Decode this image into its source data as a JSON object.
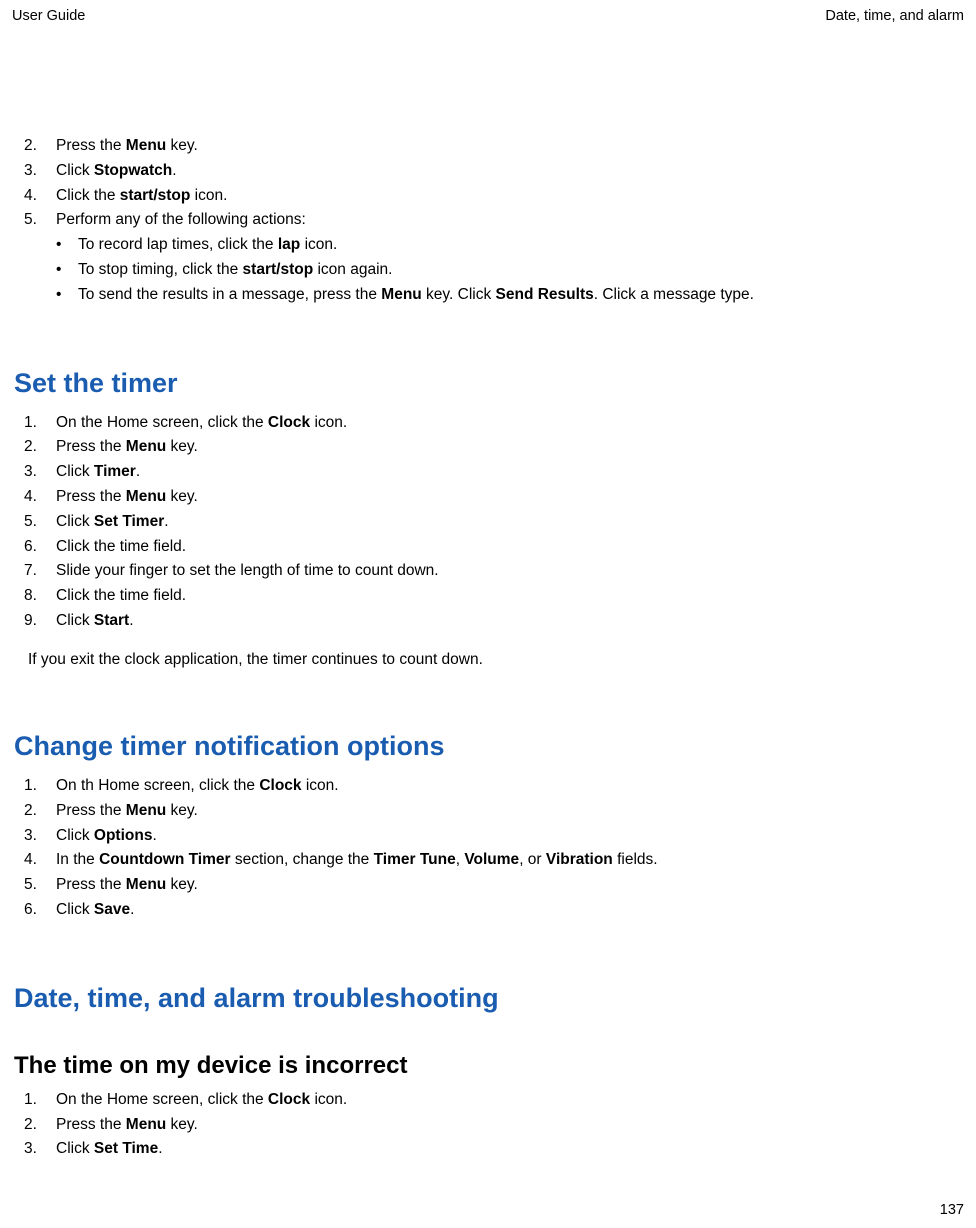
{
  "header": {
    "left": "User Guide",
    "right": "Date, time, and alarm"
  },
  "page_number": "137",
  "section1": {
    "items": [
      {
        "num": "2.",
        "pre": "Press the ",
        "bold": "Menu",
        "post": " key."
      },
      {
        "num": "3.",
        "pre": "Click ",
        "bold": "Stopwatch",
        "post": "."
      },
      {
        "num": "4.",
        "pre": "Click the ",
        "bold": "start/stop",
        "post": " icon."
      },
      {
        "num": "5.",
        "pre": "Perform any of the following actions:",
        "bold": "",
        "post": ""
      }
    ],
    "bullets": [
      {
        "pre": "To record lap times, click the ",
        "bold": "lap",
        "post": " icon."
      },
      {
        "pre": "To stop timing, click the ",
        "bold": "start/stop",
        "post": " icon again."
      },
      {
        "pre": "To send the results in a message, press the ",
        "bold": "Menu",
        "mid": " key. Click ",
        "bold2": "Send Results",
        "post": ". Click a message type."
      }
    ]
  },
  "section2": {
    "heading": "Set the timer",
    "items": [
      {
        "num": "1.",
        "pre": "On the Home screen, click the ",
        "bold": "Clock",
        "post": " icon."
      },
      {
        "num": "2.",
        "pre": "Press the ",
        "bold": "Menu",
        "post": " key."
      },
      {
        "num": "3.",
        "pre": "Click ",
        "bold": "Timer",
        "post": "."
      },
      {
        "num": "4.",
        "pre": "Press the ",
        "bold": "Menu",
        "post": " key."
      },
      {
        "num": "5.",
        "pre": "Click ",
        "bold": "Set Timer",
        "post": "."
      },
      {
        "num": "6.",
        "pre": "Click the time field.",
        "bold": "",
        "post": ""
      },
      {
        "num": "7.",
        "pre": "Slide your finger to set the length of time to count down.",
        "bold": "",
        "post": ""
      },
      {
        "num": "8.",
        "pre": "Click the time field.",
        "bold": "",
        "post": ""
      },
      {
        "num": "9.",
        "pre": "Click ",
        "bold": "Start",
        "post": "."
      }
    ],
    "note": "If you exit the clock application, the timer continues to count down."
  },
  "section3": {
    "heading": "Change timer notification options",
    "items": [
      {
        "num": "1.",
        "pre": "On th Home screen, click the ",
        "bold": "Clock",
        "post": " icon."
      },
      {
        "num": "2.",
        "pre": "Press the ",
        "bold": "Menu",
        "post": " key."
      },
      {
        "num": "3.",
        "pre": "Click ",
        "bold": "Options",
        "post": "."
      },
      {
        "num": "4.",
        "pre": "In the ",
        "bold": "Countdown Timer",
        "mid": " section, change the ",
        "bold2": "Timer Tune",
        "mid2": ", ",
        "bold3": "Volume",
        "mid3": ", or ",
        "bold4": "Vibration",
        "post": " fields."
      },
      {
        "num": "5.",
        "pre": "Press the ",
        "bold": "Menu",
        "post": " key."
      },
      {
        "num": "6.",
        "pre": "Click ",
        "bold": "Save",
        "post": "."
      }
    ]
  },
  "section4": {
    "heading": "Date, time, and alarm troubleshooting",
    "subheading": "The time on my device is incorrect",
    "items": [
      {
        "num": "1.",
        "pre": "On the Home screen, click the ",
        "bold": "Clock",
        "post": " icon."
      },
      {
        "num": "2.",
        "pre": "Press the ",
        "bold": "Menu",
        "post": " key."
      },
      {
        "num": "3.",
        "pre": "Click ",
        "bold": "Set Time",
        "post": "."
      }
    ]
  }
}
